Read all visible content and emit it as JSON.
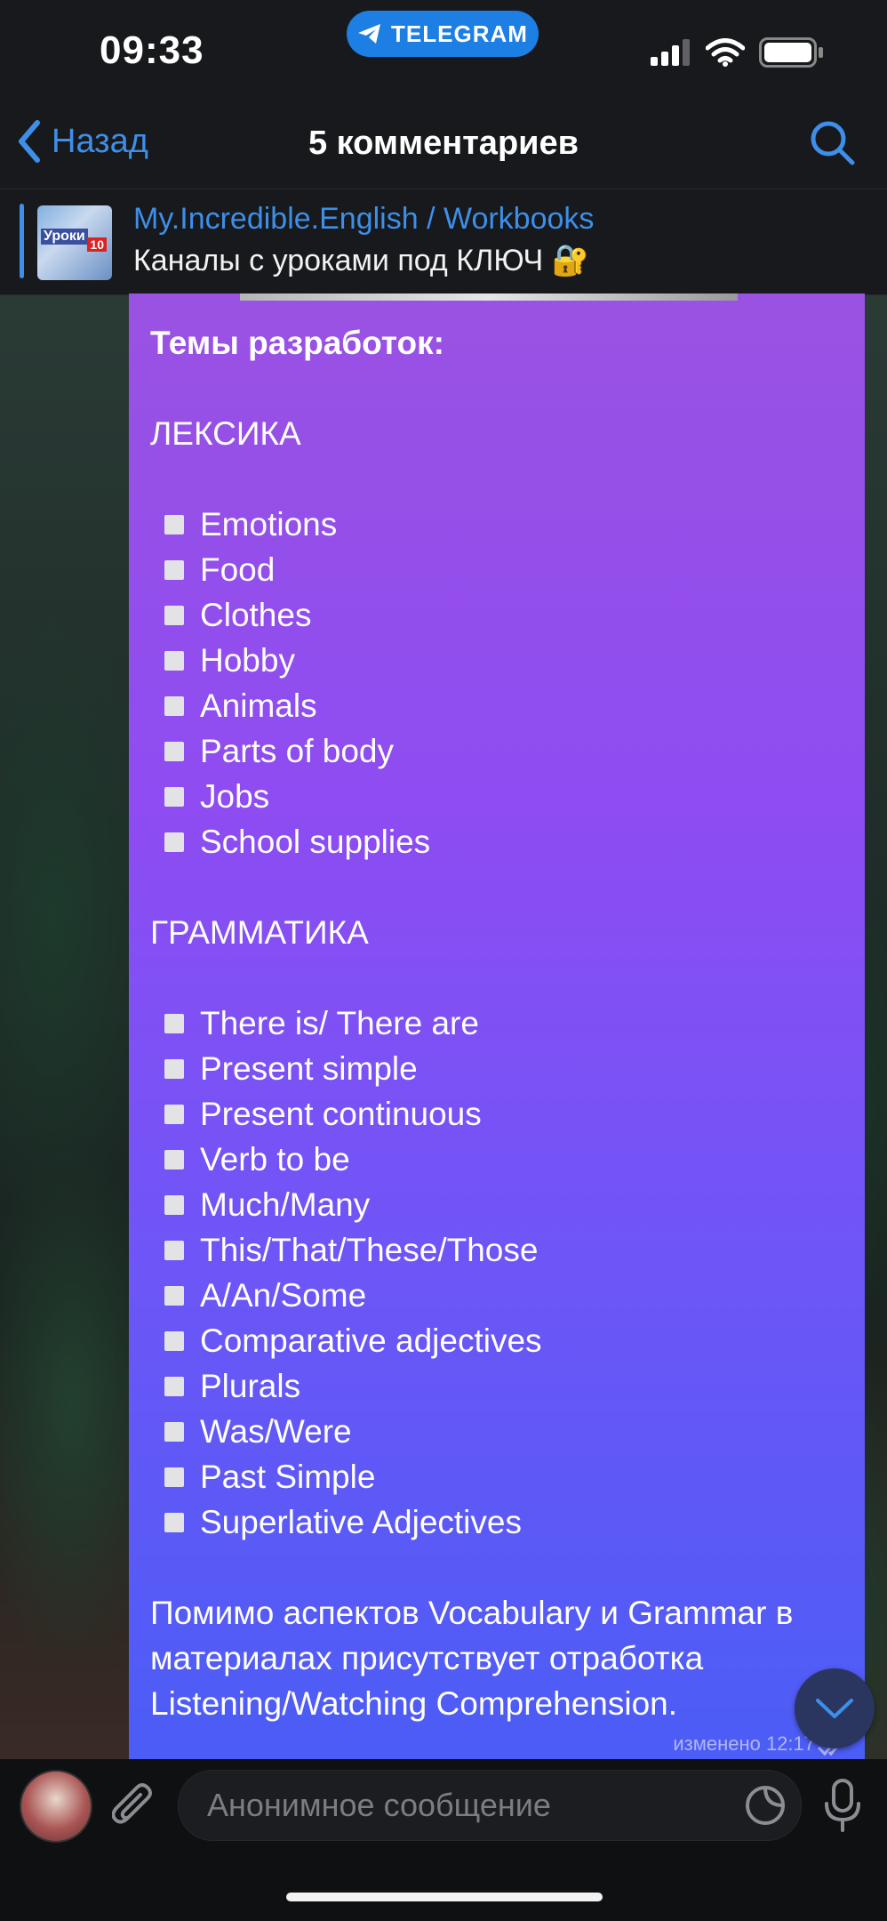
{
  "status_bar": {
    "time": "09:33",
    "pill_label": "TELEGRAM",
    "icons": [
      "signal-icon",
      "wifi-icon",
      "battery-icon"
    ]
  },
  "nav": {
    "back_label": "Назад",
    "title": "5 комментариев",
    "search_icon": "search-icon"
  },
  "pinned": {
    "thumb_text_1": "Уроки",
    "thumb_text_2": "10",
    "channel": "My.Incredible.English / Workbooks",
    "text": "Каналы с уроками под КЛЮЧ 🔐"
  },
  "message": {
    "heading": "Темы разработок:",
    "vocab_title": "ЛЕКСИКА",
    "vocab_items": [
      "Emotions",
      "Food",
      "Clothes",
      "Hobby",
      "Animals",
      "Parts of body",
      "Jobs",
      "School supplies"
    ],
    "grammar_title": "ГРАММАТИКА",
    "grammar_items": [
      "There is/ There are",
      "Present simple",
      "Present continuous",
      "Verb to be",
      "Much/Many",
      "This/That/These/Those",
      "A/An/Some",
      "Comparative adjectives",
      "Plurals",
      "Was/Were",
      "Past Simple",
      "Superlative Adjectives"
    ],
    "closing": "Помимо аспектов Vocabulary и Grammar в материалах присутствует отработка Listening/Watching Comprehension.",
    "edited": "изменено 12:17",
    "colors": {
      "bubble_top": "#9a52e2",
      "bubble_bottom": "#4b5df6"
    }
  },
  "input": {
    "placeholder": "Анонимное сообщение",
    "accent": "#3d8fe8"
  }
}
